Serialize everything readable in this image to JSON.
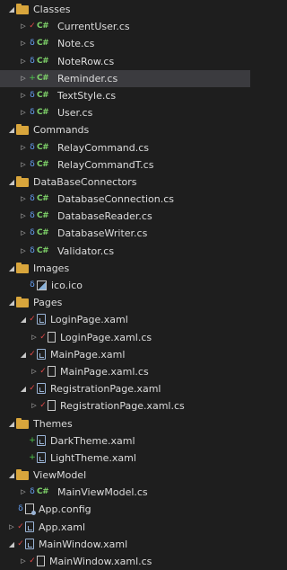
{
  "tree": {
    "items": [
      {
        "label": "Classes",
        "level": 0,
        "kind": "folder",
        "expander": "expanded",
        "status": ""
      },
      {
        "label": "CurrentUser.cs",
        "level": 1,
        "kind": "cs",
        "expander": "collapsed",
        "status": "check"
      },
      {
        "label": "Note.cs",
        "level": 1,
        "kind": "cs",
        "expander": "collapsed",
        "status": "lock"
      },
      {
        "label": "NoteRow.cs",
        "level": 1,
        "kind": "cs",
        "expander": "collapsed",
        "status": "lock"
      },
      {
        "label": "Reminder.cs",
        "level": 1,
        "kind": "cs",
        "expander": "collapsed",
        "status": "plus",
        "selected": true
      },
      {
        "label": "TextStyle.cs",
        "level": 1,
        "kind": "cs",
        "expander": "collapsed",
        "status": "lock"
      },
      {
        "label": "User.cs",
        "level": 1,
        "kind": "cs",
        "expander": "collapsed",
        "status": "lock"
      },
      {
        "label": "Commands",
        "level": 0,
        "kind": "folder",
        "expander": "expanded",
        "status": ""
      },
      {
        "label": "RelayCommand.cs",
        "level": 1,
        "kind": "cs",
        "expander": "collapsed",
        "status": "lock"
      },
      {
        "label": "RelayCommandT.cs",
        "level": 1,
        "kind": "cs",
        "expander": "collapsed",
        "status": "lock"
      },
      {
        "label": "DataBaseConnectors",
        "level": 0,
        "kind": "folder",
        "expander": "expanded",
        "status": ""
      },
      {
        "label": "DatabaseConnection.cs",
        "level": 1,
        "kind": "cs",
        "expander": "collapsed",
        "status": "lock"
      },
      {
        "label": "DatabaseReader.cs",
        "level": 1,
        "kind": "cs",
        "expander": "collapsed",
        "status": "lock"
      },
      {
        "label": "DatabaseWriter.cs",
        "level": 1,
        "kind": "cs",
        "expander": "collapsed",
        "status": "lock"
      },
      {
        "label": "Validator.cs",
        "level": 1,
        "kind": "cs",
        "expander": "collapsed",
        "status": "lock"
      },
      {
        "label": "Images",
        "level": 0,
        "kind": "folder",
        "expander": "expanded",
        "status": ""
      },
      {
        "label": "ico.ico",
        "level": 1,
        "kind": "image",
        "expander": "none",
        "status": "lock"
      },
      {
        "label": "Pages",
        "level": 0,
        "kind": "folder",
        "expander": "expanded",
        "status": ""
      },
      {
        "label": "LoginPage.xaml",
        "level": 1,
        "kind": "xaml",
        "expander": "expanded",
        "status": "check"
      },
      {
        "label": "LoginPage.xaml.cs",
        "level": 2,
        "kind": "doc",
        "expander": "collapsed",
        "status": "check"
      },
      {
        "label": "MainPage.xaml",
        "level": 1,
        "kind": "xaml",
        "expander": "expanded",
        "status": "check"
      },
      {
        "label": "MainPage.xaml.cs",
        "level": 2,
        "kind": "doc",
        "expander": "collapsed",
        "status": "check"
      },
      {
        "label": "RegistrationPage.xaml",
        "level": 1,
        "kind": "xaml",
        "expander": "expanded",
        "status": "check"
      },
      {
        "label": "RegistrationPage.xaml.cs",
        "level": 2,
        "kind": "doc",
        "expander": "collapsed",
        "status": "check"
      },
      {
        "label": "Themes",
        "level": 0,
        "kind": "folder",
        "expander": "expanded",
        "status": ""
      },
      {
        "label": "DarkTheme.xaml",
        "level": 1,
        "kind": "xaml",
        "expander": "none",
        "status": "plus"
      },
      {
        "label": "LightTheme.xaml",
        "level": 1,
        "kind": "xaml",
        "expander": "none",
        "status": "plus"
      },
      {
        "label": "ViewModel",
        "level": 0,
        "kind": "folder",
        "expander": "expanded",
        "status": ""
      },
      {
        "label": "MainViewModel.cs",
        "level": 1,
        "kind": "cs",
        "expander": "collapsed",
        "status": "lock"
      },
      {
        "label": "App.config",
        "level": 0,
        "kind": "config",
        "expander": "none",
        "status": "lock"
      },
      {
        "label": "App.xaml",
        "level": 0,
        "kind": "xaml",
        "expander": "collapsed",
        "status": "check"
      },
      {
        "label": "MainWindow.xaml",
        "level": 0,
        "kind": "xaml",
        "expander": "expanded",
        "status": "check"
      },
      {
        "label": "MainWindow.xaml.cs",
        "level": 1,
        "kind": "doc",
        "expander": "collapsed",
        "status": "check"
      }
    ]
  },
  "icons": {
    "expanded": "chevron-down-icon",
    "collapsed": "chevron-right-icon",
    "lock": "lock-icon",
    "check": "checkmark-icon",
    "plus": "plus-icon",
    "folder": "folder-icon",
    "cs": "csharp-file-icon",
    "xaml": "xaml-file-icon",
    "doc": "code-file-icon",
    "image": "image-file-icon",
    "config": "config-file-icon"
  },
  "colors": {
    "background": "#1e1e1e",
    "selection": "#3b3b3f",
    "text": "#dcdcdc",
    "folder": "#d8a53c",
    "csharp": "#7fd36a",
    "lock": "#6aa7ff",
    "check": "#e04848",
    "plus": "#4ec94e"
  }
}
